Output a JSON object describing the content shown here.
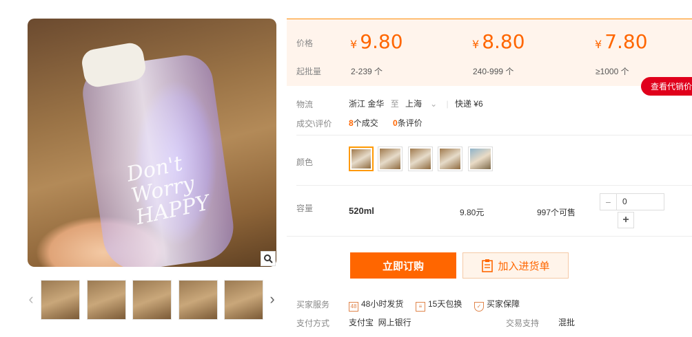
{
  "gallery": {
    "bottle_text": [
      "Don't",
      "Worry",
      "HAPPY"
    ],
    "zoom_icon": "magnifier-icon",
    "thumbnail_count": 5
  },
  "price": {
    "price_label": "价格",
    "moq_label": "起批量",
    "currency": "¥",
    "tiers": [
      {
        "price": "9.80",
        "range": "2-239 个"
      },
      {
        "price": "8.80",
        "range": "240-999 个"
      },
      {
        "price": "7.80",
        "range": "≥1000 个"
      }
    ],
    "agent_button": "查看代销价"
  },
  "logistics": {
    "label": "物流",
    "from": "浙江 金华",
    "to_word": "至",
    "to": "上海",
    "express": "快递 ¥6"
  },
  "deals": {
    "label": "成交\\评价",
    "deal_count": "8",
    "deal_suffix": "个成交",
    "review_count": "0",
    "review_suffix": "条评价"
  },
  "color": {
    "label": "颜色"
  },
  "capacity": {
    "label": "容量",
    "spec": "520ml",
    "price": "9.80元",
    "stock": "997个可售",
    "quantity": "0",
    "minus": "−",
    "plus": "+"
  },
  "actions": {
    "buy_now": "立即订购",
    "add_cart": "加入进货单"
  },
  "services": {
    "label": "买家服务",
    "items": [
      "48小时发货",
      "15天包换",
      "买家保障"
    ],
    "payment_label": "支付方式",
    "payment_values": "支付宝  网上银行",
    "trade_label": "交易支持",
    "trade_value": "混批"
  },
  "colors": {
    "accent": "#ff6600",
    "price_bg": "#fff4ec",
    "agent_red": "#e0001b"
  }
}
